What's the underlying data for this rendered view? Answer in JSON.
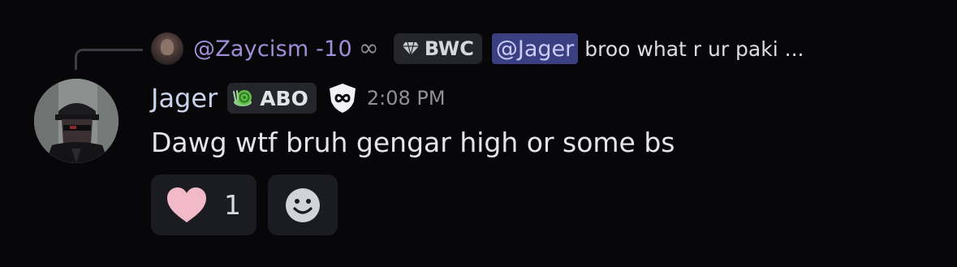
{
  "reply": {
    "username": "@Zaycism -10",
    "badge_icon": "infinity-icon",
    "tag_label": "BWC",
    "tag_icon": "gem-icon",
    "mention": "@Jager",
    "preview": "broo what r ur paki ..."
  },
  "message": {
    "author": "Jager",
    "role_label": "ABO",
    "role_icon": "snail-icon",
    "badge_icon": "infinity-shield-icon",
    "timestamp": "2:08 PM",
    "text": "Dawg wtf bruh gengar high or some bs"
  },
  "reactions": [
    {
      "emoji": "heart-icon",
      "count": "1"
    }
  ],
  "add_reaction_icon": "smiley-icon",
  "colors": {
    "background": "#070709",
    "reply_username": "#a08fd8",
    "mention_bg": "#3a3f82",
    "author": "#c8d3ea",
    "heart": "#f2b9c8"
  }
}
